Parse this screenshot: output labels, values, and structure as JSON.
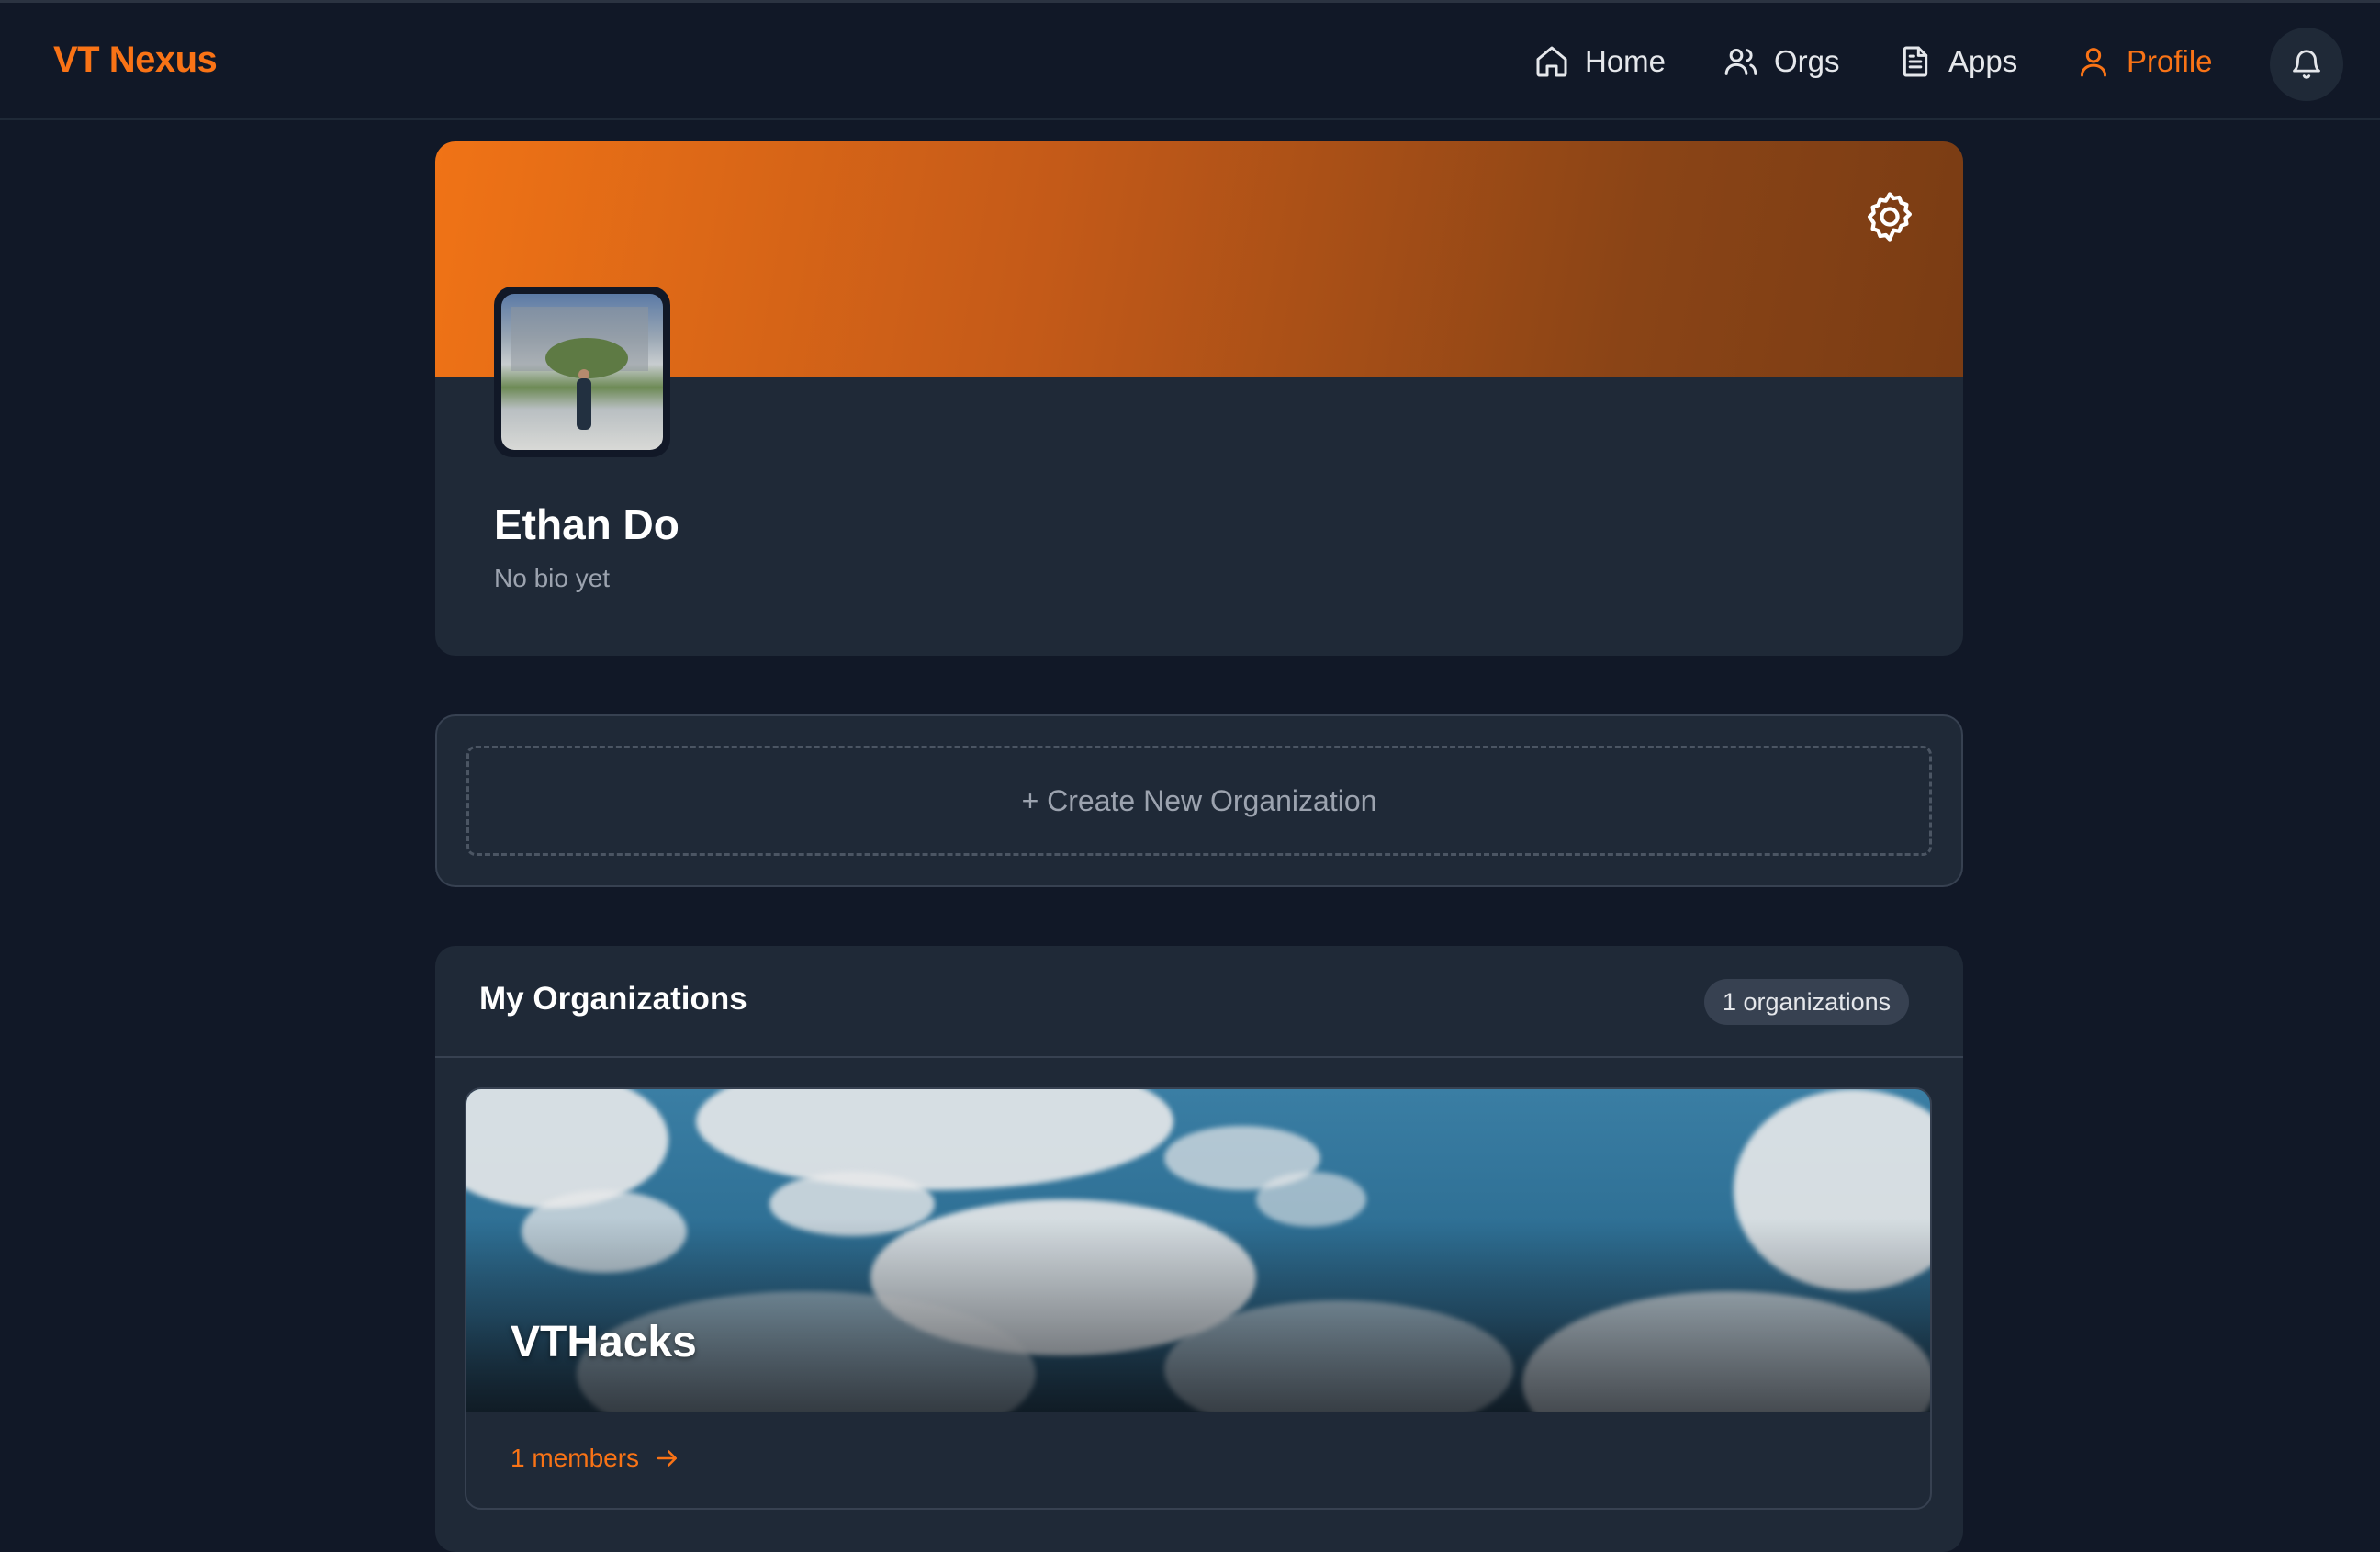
{
  "nav": {
    "logo": "VT Nexus",
    "items": [
      {
        "label": "Home",
        "icon": "home-icon"
      },
      {
        "label": "Orgs",
        "icon": "users-icon"
      },
      {
        "label": "Apps",
        "icon": "document-icon"
      },
      {
        "label": "Profile",
        "icon": "user-icon",
        "active": true
      }
    ],
    "notifications_icon": "bell-icon"
  },
  "profile": {
    "name": "Ethan Do",
    "bio": "No bio yet",
    "settings_icon": "gear-icon",
    "banner_colors": [
      "#f07316",
      "#7a3c14"
    ]
  },
  "create": {
    "label": "+ Create New Organization"
  },
  "organizations": {
    "title": "My Organizations",
    "count_label": "1 organizations",
    "items": [
      {
        "name": "VTHacks",
        "members_label": "1 members"
      }
    ]
  },
  "colors": {
    "accent": "#f97316",
    "background": "#111827",
    "card": "#1f2937",
    "border": "#374151"
  }
}
